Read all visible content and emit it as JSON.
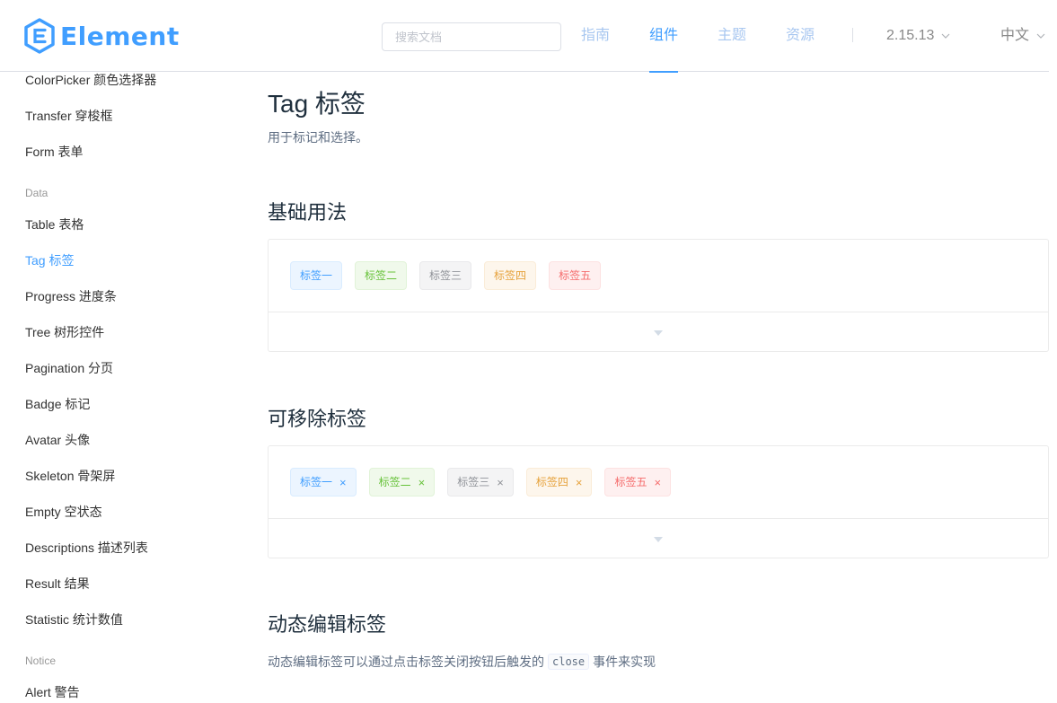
{
  "header": {
    "logo_text": "Element",
    "search_placeholder": "搜索文档",
    "nav": [
      {
        "label": "指南"
      },
      {
        "label": "组件"
      },
      {
        "label": "主题"
      },
      {
        "label": "资源"
      }
    ],
    "active_nav": "组件",
    "version": "2.15.13",
    "language": "中文"
  },
  "sidebar": {
    "items_top": [
      "ColorPicker 颜色选择器",
      "Transfer 穿梭框",
      "Form 表单"
    ],
    "group_data": "Data",
    "items_data": [
      "Table 表格",
      "Tag 标签",
      "Progress 进度条",
      "Tree 树形控件",
      "Pagination 分页",
      "Badge 标记",
      "Avatar 头像",
      "Skeleton 骨架屏",
      "Empty 空状态",
      "Descriptions 描述列表",
      "Result 结果",
      "Statistic 统计数值"
    ],
    "group_notice": "Notice",
    "items_notice": [
      "Alert 警告"
    ],
    "active_item": "Tag 标签"
  },
  "main": {
    "title": "Tag 标签",
    "description": "用于标记和选择。",
    "sections": [
      {
        "title": "基础用法",
        "tags": [
          "标签一",
          "标签二",
          "标签三",
          "标签四",
          "标签五"
        ]
      },
      {
        "title": "可移除标签",
        "tags": [
          "标签一",
          "标签二",
          "标签三",
          "标签四",
          "标签五"
        ],
        "close_glyph": "×"
      },
      {
        "title": "动态编辑标签"
      }
    ],
    "dynamic_desc_before": "动态编辑标签可以通过点击标签关闭按钮后触发的",
    "dynamic_desc_code": "close",
    "dynamic_desc_after": "事件来实现"
  },
  "colors": {
    "accent": "#409eff",
    "success": "#67c23a",
    "info": "#909399",
    "warning": "#e6a23c",
    "danger": "#f56c6c"
  }
}
